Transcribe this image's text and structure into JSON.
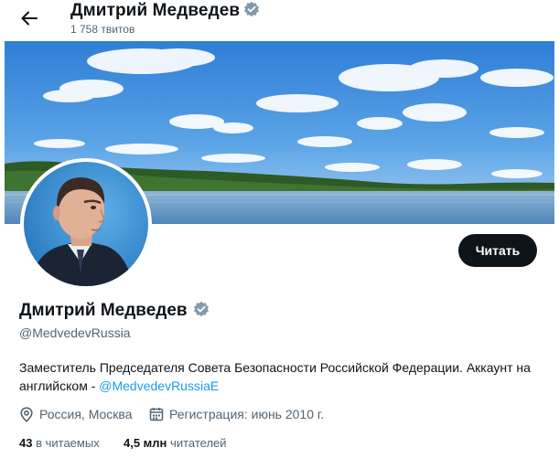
{
  "header": {
    "name": "Дмитрий Медведев",
    "tweet_count": "1 758 твитов"
  },
  "profile": {
    "display_name": "Дмитрий Медведев",
    "handle": "@MedvedevRussia",
    "bio_text": "Заместитель Председателя Совета Безопасности Российской Федерации. Аккаунт на английском - ",
    "bio_link": "@MedvedevRussiaE",
    "location": "Россия, Москва",
    "joined": "Регистрация: июнь 2010 г.",
    "following_count": "43",
    "following_label": "в читаемых",
    "followers_count": "4,5 млн",
    "followers_label": "читателей"
  },
  "actions": {
    "follow_label": "Читать"
  },
  "icons": {
    "back": "arrow-left-icon",
    "verified": "verified-badge-icon",
    "location": "location-pin-icon",
    "calendar": "calendar-icon"
  },
  "colors": {
    "text": "#0f1419",
    "secondary": "#536471",
    "link": "#1d9bf0",
    "button_bg": "#0f1419",
    "button_text": "#ffffff"
  }
}
